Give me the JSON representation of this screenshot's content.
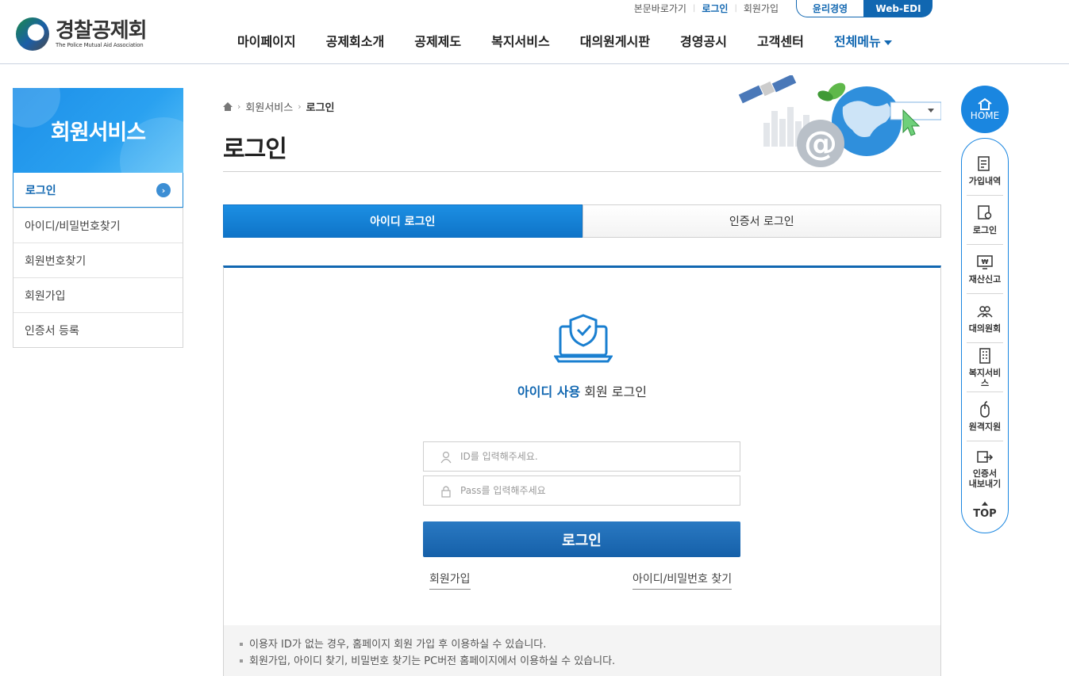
{
  "header": {
    "logo_ko": "경찰공제회",
    "logo_en": "The Police Mutual Aid Association",
    "util": {
      "skip": "본문바로가기",
      "login": "로그인",
      "join": "회원가입",
      "ethics": "윤리경영",
      "webedi": "Web-EDI"
    },
    "gnb": [
      "마이페이지",
      "공제회소개",
      "공제제도",
      "복지서비스",
      "대의원게시판",
      "경영공시",
      "고객센터"
    ],
    "gnb_all": "전체메뉴"
  },
  "sidebar": {
    "title": "회원서비스",
    "items": [
      {
        "label": "로그인",
        "active": true
      },
      {
        "label": "아이디/비밀번호찾기"
      },
      {
        "label": "회원번호찾기"
      },
      {
        "label": "회원가입"
      },
      {
        "label": "인증서 등록"
      }
    ]
  },
  "breadcrumb": {
    "section": "회원서비스",
    "current": "로그인"
  },
  "page_title": "로그인",
  "tabs": [
    "아이디 로그인",
    "인증서 로그인"
  ],
  "login": {
    "sub_highlight": "아이디 사용",
    "sub_rest": " 회원 로그인",
    "id_placeholder": "ID를 입력해주세요.",
    "pw_placeholder": "Pass를 입력해주세요",
    "button": "로그인",
    "link_join": "회원가입",
    "link_find": "아이디/비밀번호 찾기"
  },
  "notice": [
    "이용자 ID가 없는 경우, 홈페이지 회원 가입 후 이용하실 수 있습니다.",
    "회원가입, 아이디 찾기, 비밀번호 찾기는 PC버전 홈페이지에서 이용하실 수 있습니다."
  ],
  "quick": {
    "home": "HOME",
    "items": [
      "가입내역",
      "로그인",
      "재산신고",
      "대의원회",
      "복지서비스",
      "원격지원"
    ],
    "cert_line1": "인증서",
    "cert_line2": "내보내기",
    "top": "TOP"
  },
  "colors": {
    "primary": "#1167b1",
    "accent": "#1a86e0"
  }
}
